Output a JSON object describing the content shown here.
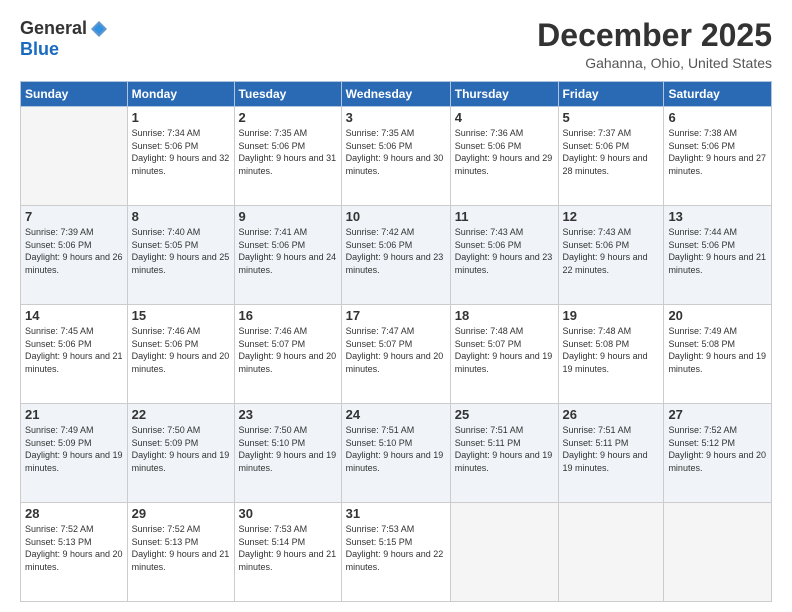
{
  "logo": {
    "general": "General",
    "blue": "Blue"
  },
  "header": {
    "month": "December 2025",
    "location": "Gahanna, Ohio, United States"
  },
  "weekdays": [
    "Sunday",
    "Monday",
    "Tuesday",
    "Wednesday",
    "Thursday",
    "Friday",
    "Saturday"
  ],
  "weeks": [
    [
      {
        "day": "",
        "sunrise": "",
        "sunset": "",
        "daylight": ""
      },
      {
        "day": "1",
        "sunrise": "Sunrise: 7:34 AM",
        "sunset": "Sunset: 5:06 PM",
        "daylight": "Daylight: 9 hours and 32 minutes."
      },
      {
        "day": "2",
        "sunrise": "Sunrise: 7:35 AM",
        "sunset": "Sunset: 5:06 PM",
        "daylight": "Daylight: 9 hours and 31 minutes."
      },
      {
        "day": "3",
        "sunrise": "Sunrise: 7:35 AM",
        "sunset": "Sunset: 5:06 PM",
        "daylight": "Daylight: 9 hours and 30 minutes."
      },
      {
        "day": "4",
        "sunrise": "Sunrise: 7:36 AM",
        "sunset": "Sunset: 5:06 PM",
        "daylight": "Daylight: 9 hours and 29 minutes."
      },
      {
        "day": "5",
        "sunrise": "Sunrise: 7:37 AM",
        "sunset": "Sunset: 5:06 PM",
        "daylight": "Daylight: 9 hours and 28 minutes."
      },
      {
        "day": "6",
        "sunrise": "Sunrise: 7:38 AM",
        "sunset": "Sunset: 5:06 PM",
        "daylight": "Daylight: 9 hours and 27 minutes."
      }
    ],
    [
      {
        "day": "7",
        "sunrise": "Sunrise: 7:39 AM",
        "sunset": "Sunset: 5:06 PM",
        "daylight": "Daylight: 9 hours and 26 minutes."
      },
      {
        "day": "8",
        "sunrise": "Sunrise: 7:40 AM",
        "sunset": "Sunset: 5:05 PM",
        "daylight": "Daylight: 9 hours and 25 minutes."
      },
      {
        "day": "9",
        "sunrise": "Sunrise: 7:41 AM",
        "sunset": "Sunset: 5:06 PM",
        "daylight": "Daylight: 9 hours and 24 minutes."
      },
      {
        "day": "10",
        "sunrise": "Sunrise: 7:42 AM",
        "sunset": "Sunset: 5:06 PM",
        "daylight": "Daylight: 9 hours and 23 minutes."
      },
      {
        "day": "11",
        "sunrise": "Sunrise: 7:43 AM",
        "sunset": "Sunset: 5:06 PM",
        "daylight": "Daylight: 9 hours and 23 minutes."
      },
      {
        "day": "12",
        "sunrise": "Sunrise: 7:43 AM",
        "sunset": "Sunset: 5:06 PM",
        "daylight": "Daylight: 9 hours and 22 minutes."
      },
      {
        "day": "13",
        "sunrise": "Sunrise: 7:44 AM",
        "sunset": "Sunset: 5:06 PM",
        "daylight": "Daylight: 9 hours and 21 minutes."
      }
    ],
    [
      {
        "day": "14",
        "sunrise": "Sunrise: 7:45 AM",
        "sunset": "Sunset: 5:06 PM",
        "daylight": "Daylight: 9 hours and 21 minutes."
      },
      {
        "day": "15",
        "sunrise": "Sunrise: 7:46 AM",
        "sunset": "Sunset: 5:06 PM",
        "daylight": "Daylight: 9 hours and 20 minutes."
      },
      {
        "day": "16",
        "sunrise": "Sunrise: 7:46 AM",
        "sunset": "Sunset: 5:07 PM",
        "daylight": "Daylight: 9 hours and 20 minutes."
      },
      {
        "day": "17",
        "sunrise": "Sunrise: 7:47 AM",
        "sunset": "Sunset: 5:07 PM",
        "daylight": "Daylight: 9 hours and 20 minutes."
      },
      {
        "day": "18",
        "sunrise": "Sunrise: 7:48 AM",
        "sunset": "Sunset: 5:07 PM",
        "daylight": "Daylight: 9 hours and 19 minutes."
      },
      {
        "day": "19",
        "sunrise": "Sunrise: 7:48 AM",
        "sunset": "Sunset: 5:08 PM",
        "daylight": "Daylight: 9 hours and 19 minutes."
      },
      {
        "day": "20",
        "sunrise": "Sunrise: 7:49 AM",
        "sunset": "Sunset: 5:08 PM",
        "daylight": "Daylight: 9 hours and 19 minutes."
      }
    ],
    [
      {
        "day": "21",
        "sunrise": "Sunrise: 7:49 AM",
        "sunset": "Sunset: 5:09 PM",
        "daylight": "Daylight: 9 hours and 19 minutes."
      },
      {
        "day": "22",
        "sunrise": "Sunrise: 7:50 AM",
        "sunset": "Sunset: 5:09 PM",
        "daylight": "Daylight: 9 hours and 19 minutes."
      },
      {
        "day": "23",
        "sunrise": "Sunrise: 7:50 AM",
        "sunset": "Sunset: 5:10 PM",
        "daylight": "Daylight: 9 hours and 19 minutes."
      },
      {
        "day": "24",
        "sunrise": "Sunrise: 7:51 AM",
        "sunset": "Sunset: 5:10 PM",
        "daylight": "Daylight: 9 hours and 19 minutes."
      },
      {
        "day": "25",
        "sunrise": "Sunrise: 7:51 AM",
        "sunset": "Sunset: 5:11 PM",
        "daylight": "Daylight: 9 hours and 19 minutes."
      },
      {
        "day": "26",
        "sunrise": "Sunrise: 7:51 AM",
        "sunset": "Sunset: 5:11 PM",
        "daylight": "Daylight: 9 hours and 19 minutes."
      },
      {
        "day": "27",
        "sunrise": "Sunrise: 7:52 AM",
        "sunset": "Sunset: 5:12 PM",
        "daylight": "Daylight: 9 hours and 20 minutes."
      }
    ],
    [
      {
        "day": "28",
        "sunrise": "Sunrise: 7:52 AM",
        "sunset": "Sunset: 5:13 PM",
        "daylight": "Daylight: 9 hours and 20 minutes."
      },
      {
        "day": "29",
        "sunrise": "Sunrise: 7:52 AM",
        "sunset": "Sunset: 5:13 PM",
        "daylight": "Daylight: 9 hours and 21 minutes."
      },
      {
        "day": "30",
        "sunrise": "Sunrise: 7:53 AM",
        "sunset": "Sunset: 5:14 PM",
        "daylight": "Daylight: 9 hours and 21 minutes."
      },
      {
        "day": "31",
        "sunrise": "Sunrise: 7:53 AM",
        "sunset": "Sunset: 5:15 PM",
        "daylight": "Daylight: 9 hours and 22 minutes."
      },
      {
        "day": "",
        "sunrise": "",
        "sunset": "",
        "daylight": ""
      },
      {
        "day": "",
        "sunrise": "",
        "sunset": "",
        "daylight": ""
      },
      {
        "day": "",
        "sunrise": "",
        "sunset": "",
        "daylight": ""
      }
    ]
  ]
}
